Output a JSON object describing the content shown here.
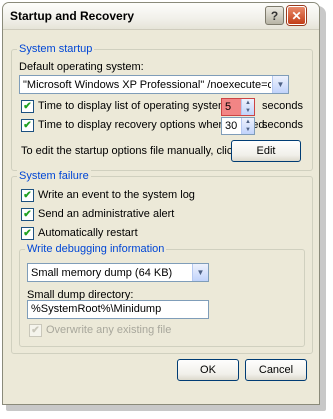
{
  "window": {
    "title": "Startup and Recovery"
  },
  "system_startup": {
    "legend": "System startup",
    "default_os_label": "Default operating system:",
    "default_os_value": "\"Microsoft Windows XP Professional\" /noexecute=optin /fastdete",
    "time_list_label": "Time to display list of operating systems:",
    "time_list_value": "5",
    "time_list_checked": true,
    "time_recovery_label": "Time to display recovery options when needed:",
    "time_recovery_value": "30",
    "time_recovery_checked": true,
    "seconds_label": "seconds",
    "edit_hint": "To edit the startup options file manually, click Edit.",
    "edit_button": "Edit"
  },
  "system_failure": {
    "legend": "System failure",
    "write_event_label": "Write an event to the system log",
    "send_alert_label": "Send an administrative alert",
    "auto_restart_label": "Automatically restart",
    "debug_legend": "Write debugging information",
    "dump_type": "Small memory dump (64 KB)",
    "dump_dir_label": "Small dump directory:",
    "dump_dir_value": "%SystemRoot%\\Minidump",
    "overwrite_label": "Overwrite any existing file"
  },
  "footer": {
    "ok_label": "OK",
    "cancel_label": "Cancel"
  },
  "colors": {
    "legend": "#0046d5",
    "dialog_bg": "#ece9d8",
    "highlight": "#f28585"
  }
}
